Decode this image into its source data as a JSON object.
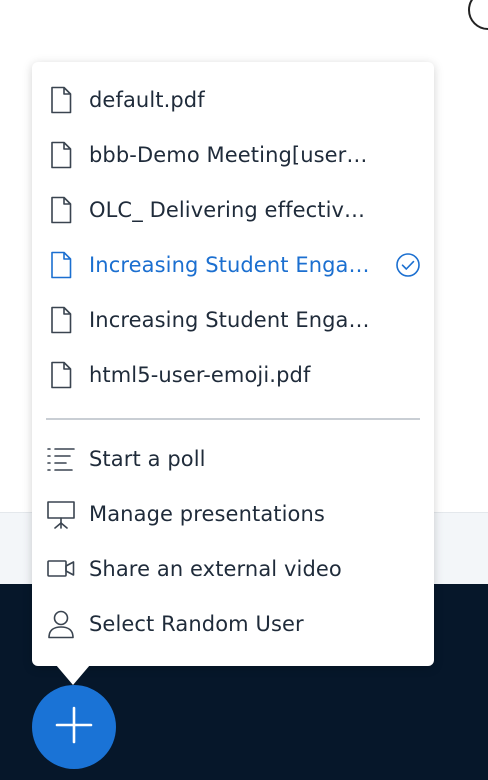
{
  "colors": {
    "accent": "#1b6fd0",
    "text": "#1f2b3a",
    "dark_bg": "#06172a",
    "fab": "#1a73d6"
  },
  "presentations": [
    {
      "name": "default.pdf",
      "icon": "file-icon",
      "selected": false
    },
    {
      "name": "bbb-Demo Meeting[user…",
      "icon": "file-icon",
      "selected": false
    },
    {
      "name": "OLC_ Delivering effectiv…",
      "icon": "file-icon",
      "selected": false
    },
    {
      "name": "Increasing Student Enga…",
      "icon": "file-icon",
      "selected": true
    },
    {
      "name": "Increasing Student Enga…",
      "icon": "file-icon",
      "selected": false
    },
    {
      "name": "html5-user-emoji.pdf",
      "icon": "file-icon",
      "selected": false
    }
  ],
  "actions": [
    {
      "label": "Start a poll",
      "icon": "poll-list-icon"
    },
    {
      "label": "Manage presentations",
      "icon": "presentation-board-icon"
    },
    {
      "label": "Share an external video",
      "icon": "video-camera-icon"
    },
    {
      "label": "Select Random User",
      "icon": "user-icon"
    }
  ],
  "fab": {
    "icon": "plus-icon"
  }
}
